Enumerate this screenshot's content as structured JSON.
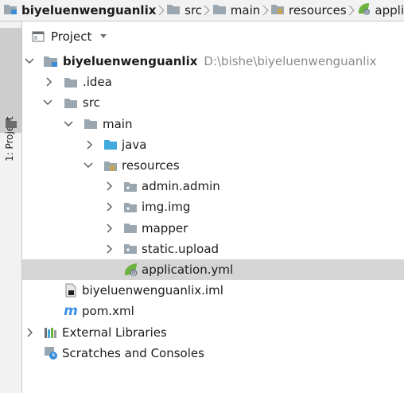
{
  "breadcrumb": [
    {
      "label": "biyeluenwenguanlix",
      "icon": "project-folder-icon"
    },
    {
      "label": "src",
      "icon": "folder-icon"
    },
    {
      "label": "main",
      "icon": "folder-icon"
    },
    {
      "label": "resources",
      "icon": "resources-folder-icon"
    },
    {
      "label": "appli",
      "icon": "spring-leaf-icon"
    }
  ],
  "stripe": {
    "tab_label": "1: Project"
  },
  "panel": {
    "title": "Project"
  },
  "tree": {
    "root": {
      "label": "biyeluenwenguanlix",
      "path": "D:\\bishe\\biyeluenwenguanlix"
    },
    "items": [
      {
        "label": ".idea"
      },
      {
        "label": "src"
      },
      {
        "label": "main"
      },
      {
        "label": "java"
      },
      {
        "label": "resources"
      },
      {
        "label": "admin.admin"
      },
      {
        "label": "img.img"
      },
      {
        "label": "mapper"
      },
      {
        "label": "static.upload"
      },
      {
        "label": "application.yml"
      },
      {
        "label": "biyeluenwenguanlix.iml"
      },
      {
        "label": "pom.xml"
      },
      {
        "label": "External Libraries"
      },
      {
        "label": "Scratches and Consoles"
      }
    ]
  },
  "colors": {
    "folder": "#9aa7b0",
    "java_folder": "#40a8dc",
    "selected_row": "#d5d5d5",
    "spring": "#6db33f"
  }
}
